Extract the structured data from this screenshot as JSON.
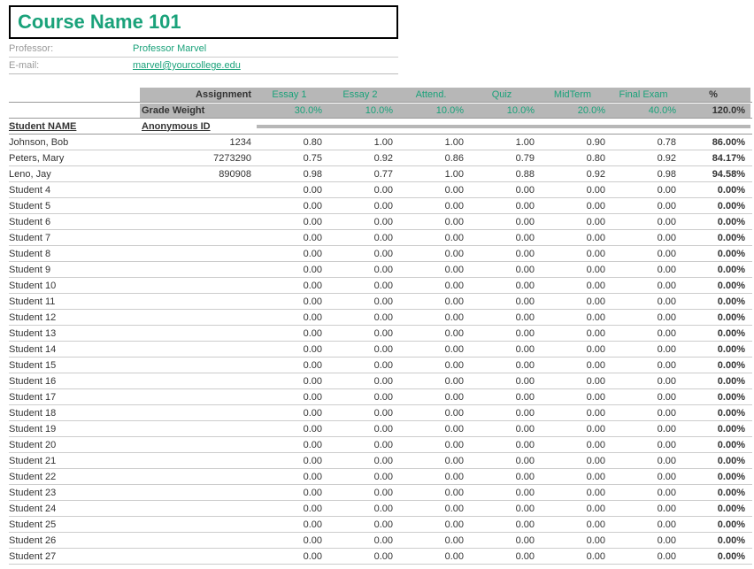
{
  "course_title": "Course Name 101",
  "info": {
    "professor_label": "Professor:",
    "professor_value": "Professor Marvel",
    "email_label": "E-mail:",
    "email_value": "marvel@yourcollege.edu"
  },
  "headers": {
    "assignment_label": "Assignment",
    "grade_weight_label": "Grade Weight",
    "student_name_label": "Student NAME",
    "anonymous_id_label": "Anonymous ID",
    "percent_label": "%",
    "total_weight": "120.0%"
  },
  "assignments": [
    {
      "name": "Essay 1",
      "weight": "30.0%"
    },
    {
      "name": "Essay 2",
      "weight": "10.0%"
    },
    {
      "name": "Attend.",
      "weight": "10.0%"
    },
    {
      "name": "Quiz",
      "weight": "10.0%"
    },
    {
      "name": "MidTerm",
      "weight": "20.0%"
    },
    {
      "name": "Final Exam",
      "weight": "40.0%"
    }
  ],
  "students": [
    {
      "name": "Johnson, Bob",
      "id": "1234",
      "scores": [
        "0.80",
        "1.00",
        "1.00",
        "1.00",
        "0.90",
        "0.78"
      ],
      "pct": "86.00%"
    },
    {
      "name": "Peters, Mary",
      "id": "7273290",
      "scores": [
        "0.75",
        "0.92",
        "0.86",
        "0.79",
        "0.80",
        "0.92"
      ],
      "pct": "84.17%"
    },
    {
      "name": "Leno, Jay",
      "id": "890908",
      "scores": [
        "0.98",
        "0.77",
        "1.00",
        "0.88",
        "0.92",
        "0.98"
      ],
      "pct": "94.58%"
    },
    {
      "name": "Student 4",
      "id": "",
      "scores": [
        "0.00",
        "0.00",
        "0.00",
        "0.00",
        "0.00",
        "0.00"
      ],
      "pct": "0.00%"
    },
    {
      "name": "Student 5",
      "id": "",
      "scores": [
        "0.00",
        "0.00",
        "0.00",
        "0.00",
        "0.00",
        "0.00"
      ],
      "pct": "0.00%"
    },
    {
      "name": "Student 6",
      "id": "",
      "scores": [
        "0.00",
        "0.00",
        "0.00",
        "0.00",
        "0.00",
        "0.00"
      ],
      "pct": "0.00%"
    },
    {
      "name": "Student 7",
      "id": "",
      "scores": [
        "0.00",
        "0.00",
        "0.00",
        "0.00",
        "0.00",
        "0.00"
      ],
      "pct": "0.00%"
    },
    {
      "name": "Student 8",
      "id": "",
      "scores": [
        "0.00",
        "0.00",
        "0.00",
        "0.00",
        "0.00",
        "0.00"
      ],
      "pct": "0.00%"
    },
    {
      "name": "Student 9",
      "id": "",
      "scores": [
        "0.00",
        "0.00",
        "0.00",
        "0.00",
        "0.00",
        "0.00"
      ],
      "pct": "0.00%"
    },
    {
      "name": "Student 10",
      "id": "",
      "scores": [
        "0.00",
        "0.00",
        "0.00",
        "0.00",
        "0.00",
        "0.00"
      ],
      "pct": "0.00%"
    },
    {
      "name": "Student 11",
      "id": "",
      "scores": [
        "0.00",
        "0.00",
        "0.00",
        "0.00",
        "0.00",
        "0.00"
      ],
      "pct": "0.00%"
    },
    {
      "name": "Student 12",
      "id": "",
      "scores": [
        "0.00",
        "0.00",
        "0.00",
        "0.00",
        "0.00",
        "0.00"
      ],
      "pct": "0.00%"
    },
    {
      "name": "Student 13",
      "id": "",
      "scores": [
        "0.00",
        "0.00",
        "0.00",
        "0.00",
        "0.00",
        "0.00"
      ],
      "pct": "0.00%"
    },
    {
      "name": "Student 14",
      "id": "",
      "scores": [
        "0.00",
        "0.00",
        "0.00",
        "0.00",
        "0.00",
        "0.00"
      ],
      "pct": "0.00%"
    },
    {
      "name": "Student 15",
      "id": "",
      "scores": [
        "0.00",
        "0.00",
        "0.00",
        "0.00",
        "0.00",
        "0.00"
      ],
      "pct": "0.00%"
    },
    {
      "name": "Student 16",
      "id": "",
      "scores": [
        "0.00",
        "0.00",
        "0.00",
        "0.00",
        "0.00",
        "0.00"
      ],
      "pct": "0.00%"
    },
    {
      "name": "Student 17",
      "id": "",
      "scores": [
        "0.00",
        "0.00",
        "0.00",
        "0.00",
        "0.00",
        "0.00"
      ],
      "pct": "0.00%"
    },
    {
      "name": "Student 18",
      "id": "",
      "scores": [
        "0.00",
        "0.00",
        "0.00",
        "0.00",
        "0.00",
        "0.00"
      ],
      "pct": "0.00%"
    },
    {
      "name": "Student 19",
      "id": "",
      "scores": [
        "0.00",
        "0.00",
        "0.00",
        "0.00",
        "0.00",
        "0.00"
      ],
      "pct": "0.00%"
    },
    {
      "name": "Student 20",
      "id": "",
      "scores": [
        "0.00",
        "0.00",
        "0.00",
        "0.00",
        "0.00",
        "0.00"
      ],
      "pct": "0.00%"
    },
    {
      "name": "Student 21",
      "id": "",
      "scores": [
        "0.00",
        "0.00",
        "0.00",
        "0.00",
        "0.00",
        "0.00"
      ],
      "pct": "0.00%"
    },
    {
      "name": "Student 22",
      "id": "",
      "scores": [
        "0.00",
        "0.00",
        "0.00",
        "0.00",
        "0.00",
        "0.00"
      ],
      "pct": "0.00%"
    },
    {
      "name": "Student 23",
      "id": "",
      "scores": [
        "0.00",
        "0.00",
        "0.00",
        "0.00",
        "0.00",
        "0.00"
      ],
      "pct": "0.00%"
    },
    {
      "name": "Student 24",
      "id": "",
      "scores": [
        "0.00",
        "0.00",
        "0.00",
        "0.00",
        "0.00",
        "0.00"
      ],
      "pct": "0.00%"
    },
    {
      "name": "Student 25",
      "id": "",
      "scores": [
        "0.00",
        "0.00",
        "0.00",
        "0.00",
        "0.00",
        "0.00"
      ],
      "pct": "0.00%"
    },
    {
      "name": "Student 26",
      "id": "",
      "scores": [
        "0.00",
        "0.00",
        "0.00",
        "0.00",
        "0.00",
        "0.00"
      ],
      "pct": "0.00%"
    },
    {
      "name": "Student 27",
      "id": "",
      "scores": [
        "0.00",
        "0.00",
        "0.00",
        "0.00",
        "0.00",
        "0.00"
      ],
      "pct": "0.00%"
    }
  ]
}
